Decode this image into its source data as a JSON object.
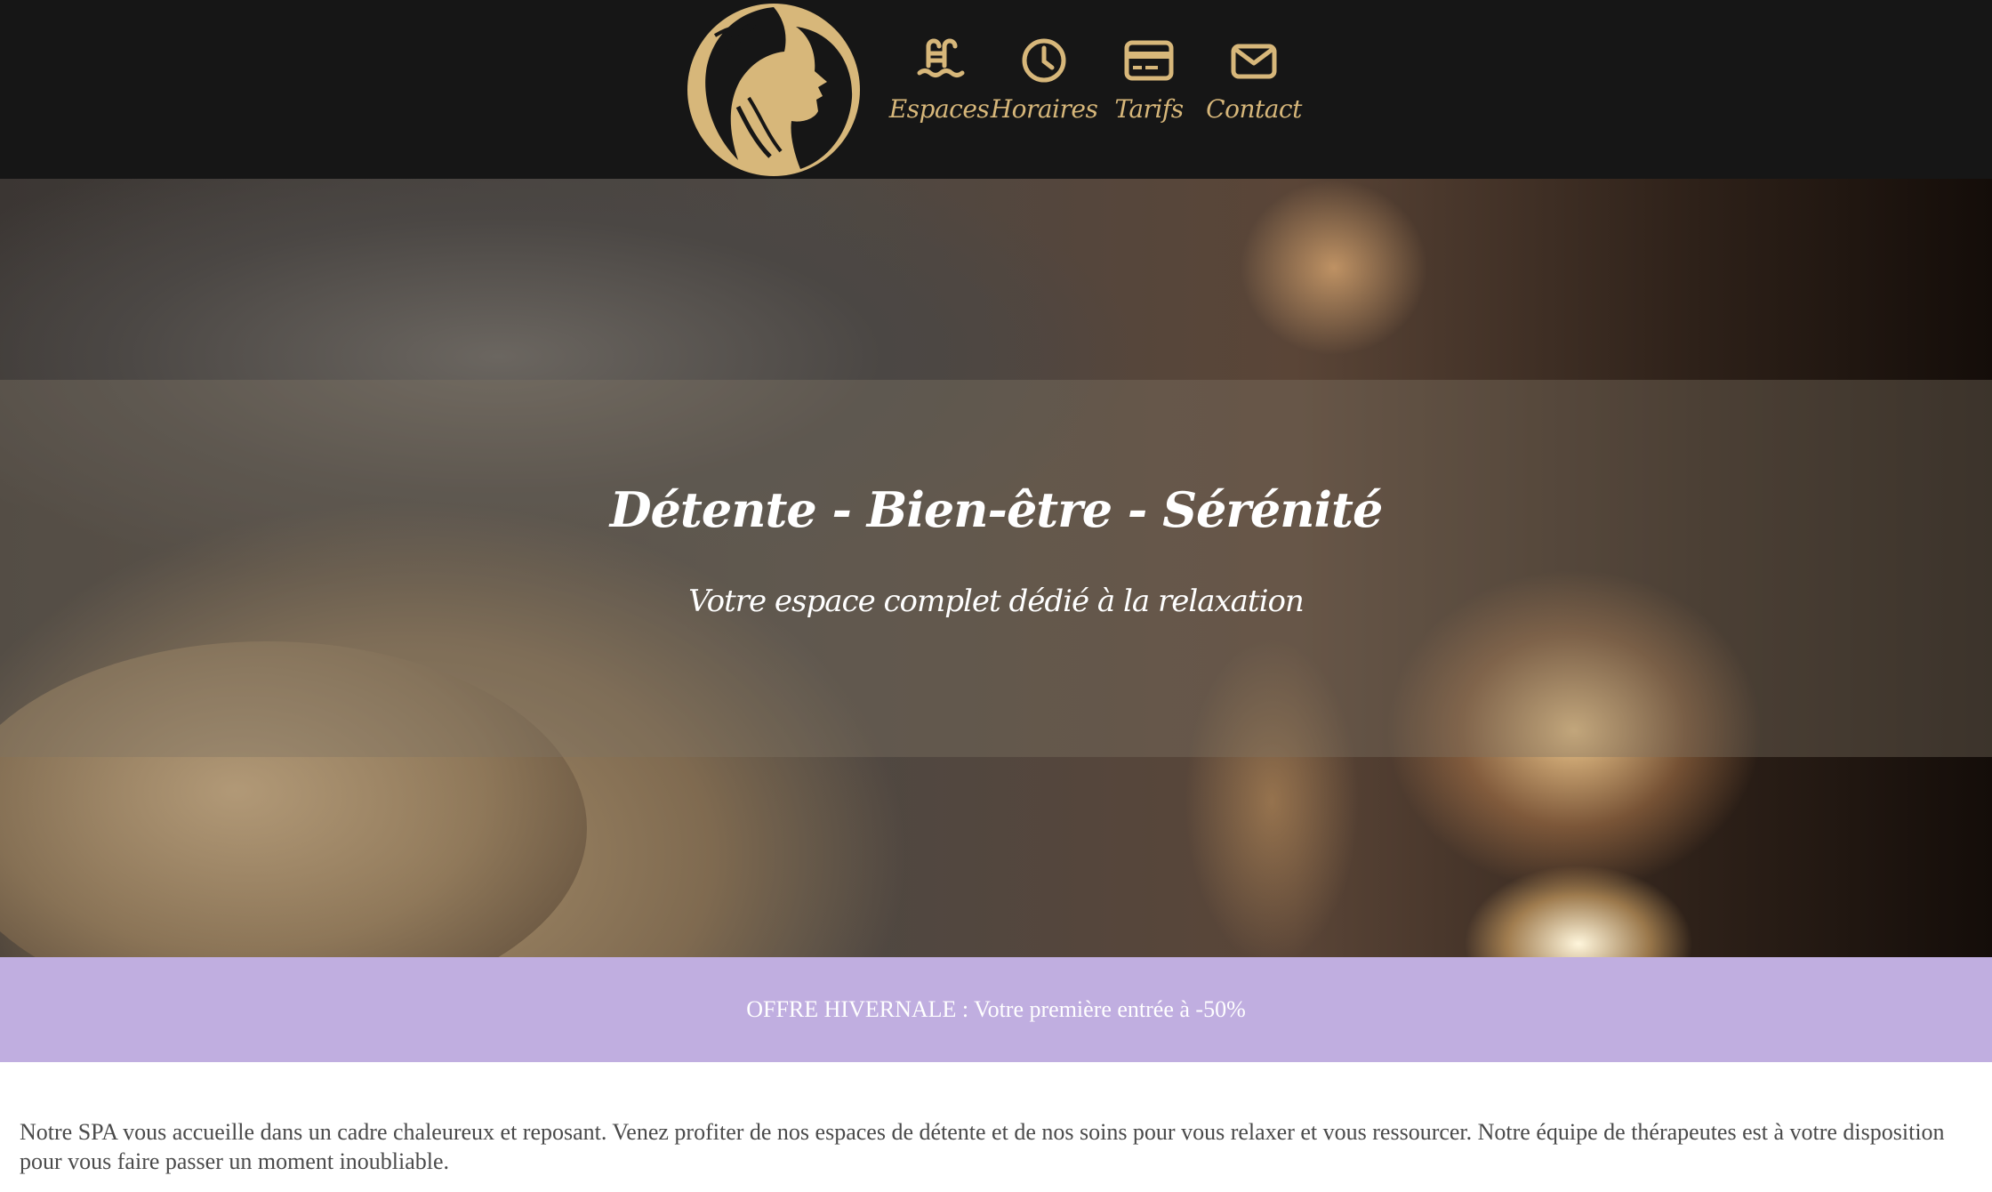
{
  "brand": {
    "logo_icon": "woman-profile-laurel-logo",
    "accent_color": "#d7b77a",
    "header_bg": "#161616"
  },
  "nav": {
    "items": [
      {
        "label": "Espaces",
        "icon": "pool-ladder-icon"
      },
      {
        "label": "Horaires",
        "icon": "clock-icon"
      },
      {
        "label": "Tarifs",
        "icon": "credit-card-icon"
      },
      {
        "label": "Contact",
        "icon": "envelope-icon"
      }
    ]
  },
  "hero": {
    "title": "Détente - Bien-être - Sérénité",
    "subtitle": "Votre espace complet dédié à la relaxation"
  },
  "promo": {
    "text": "OFFRE HIVERNALE : Votre première entrée à -50%",
    "bg_color": "#c0aee0"
  },
  "intro": {
    "text": "Notre SPA vous accueille dans un cadre chaleureux et reposant. Venez profiter de nos espaces de détente et de nos soins pour vous relaxer et vous ressourcer. Notre équipe de thérapeutes est à votre disposition pour vous faire passer un moment inoubliable."
  }
}
